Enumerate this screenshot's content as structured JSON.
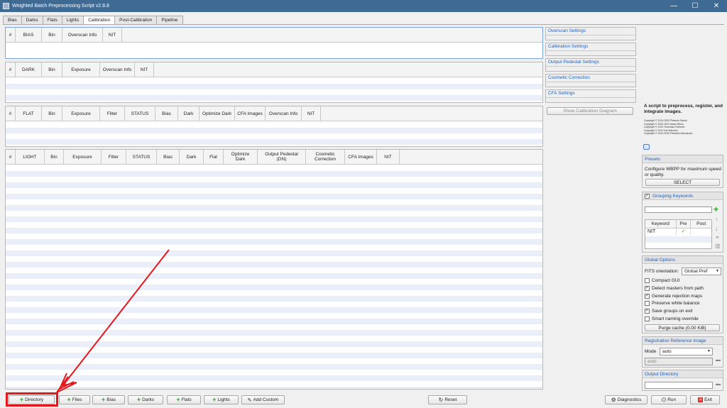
{
  "window": {
    "title": "Weighted Batch Preprocessing Script v2.8.8",
    "minimize": "—",
    "maximize": "☐",
    "close": "✕"
  },
  "tabs": [
    "Bias",
    "Darks",
    "Flats",
    "Lights",
    "Calibration",
    "Post-Calibration",
    "Pipeline"
  ],
  "tables": {
    "bias": [
      "#",
      "BIAS",
      "Bin",
      "Overscan Info",
      "NIT"
    ],
    "dark": [
      "#",
      "DARK",
      "Bin",
      "Exposure",
      "Overscan Info",
      "NIT"
    ],
    "flat": [
      "#",
      "FLAT",
      "Bin",
      "Exposure",
      "Filter",
      "STATUS",
      "Bias",
      "Dark",
      "Optimize Dark",
      "CFA Images",
      "Overscan Info",
      "NIT"
    ],
    "light": [
      "#",
      "LIGHT",
      "Bin",
      "Exposure",
      "Filter",
      "STATUS",
      "Bias",
      "Dark",
      "Flat",
      "Optimize Dark",
      "Output Pedestal (DN)",
      "Cosmetic Correction",
      "CFA Images",
      "NIT"
    ]
  },
  "calibration_settings": [
    "Overscan Settings",
    "Calibration Settings",
    "Output Pedestal Settings",
    "Cosmetic Correction",
    "CFA Settings"
  ],
  "show_diagram": "Show Calibration Diagram",
  "about": {
    "headline": "A script to preprocess, register, and integrate images.",
    "copyrights": [
      "Copyright © 2019-2020 Roberto Sartori",
      "Copyright © 2020-2021 Adam Block",
      "Copyright © 2019 Tommaso Rubechi",
      "Copyright © 2012 Kai Wiechen",
      "Copyright © 2012-2020 Pleiades Astrophoto"
    ]
  },
  "presets": {
    "title": "Presets",
    "text": "Configure WBPP for maximum speed or quality.",
    "button": "SELECT"
  },
  "grouping": {
    "title": "Grouping Keywords",
    "checked": "✓",
    "headers": [
      "Keyword",
      "Pre",
      "Post"
    ],
    "row": {
      "keyword": "NIT",
      "pre": "✓",
      "post": ""
    }
  },
  "global": {
    "title": "Global Options",
    "fits_label": "FITS orientation:",
    "fits_value": "Global Pref",
    "options": [
      {
        "label": "Compact GUI",
        "mark": ""
      },
      {
        "label": "Detect masters from path",
        "mark": "✓"
      },
      {
        "label": "Generate rejection maps",
        "mark": "✓"
      },
      {
        "label": "Preserve white balance",
        "mark": ""
      },
      {
        "label": "Save groups on exit",
        "mark": "✓"
      },
      {
        "label": "Smart naming override",
        "mark": ""
      }
    ],
    "purge": "Purge cache (0.00 KiB)"
  },
  "registration": {
    "title": "Registration Reference Image",
    "mode_label": "Mode",
    "mode_value": "auto",
    "ref_value": "auto"
  },
  "output": {
    "title": "Output Directory",
    "value": ""
  },
  "bottom": {
    "directory": "Directory",
    "files": "Files",
    "bias": "Bias",
    "darks": "Darks",
    "flats": "Flats",
    "lights": "Lights",
    "add_custom": "Add Custom",
    "reset": "Reset",
    "diagnostics": "Diagnostics",
    "run": "Run",
    "exit": "Exit"
  },
  "colors": {
    "annotation": "#e8151b",
    "accent": "#1f5fbf"
  }
}
